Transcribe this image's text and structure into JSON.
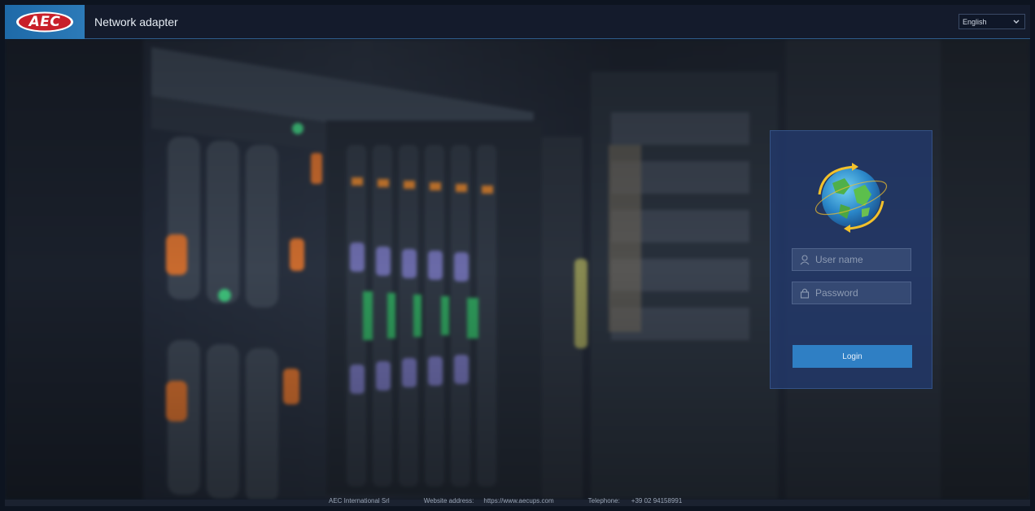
{
  "header": {
    "logo_text": "AEC",
    "title": "Network adapter",
    "language": {
      "selected": "English",
      "icon": "chevron-down-icon"
    }
  },
  "login": {
    "username_placeholder": "User name",
    "password_placeholder": "Password",
    "username_icon": "user-icon",
    "password_icon": "lock-icon",
    "globe_icon": "globe-icon",
    "button_label": "Login"
  },
  "footer": {
    "company": "AEC International Srl",
    "website_label": "Website address:",
    "website_value": "https://www.aecups.com",
    "telephone_label": "Telephone:",
    "telephone_value": "+39 02 94158991"
  },
  "colors": {
    "header_bg": "#141b2c",
    "logo_bg": "#2c7ab8",
    "logo_red": "#c8202a",
    "panel_bg": "#223a6e",
    "button_bg": "#2f7fc4"
  }
}
